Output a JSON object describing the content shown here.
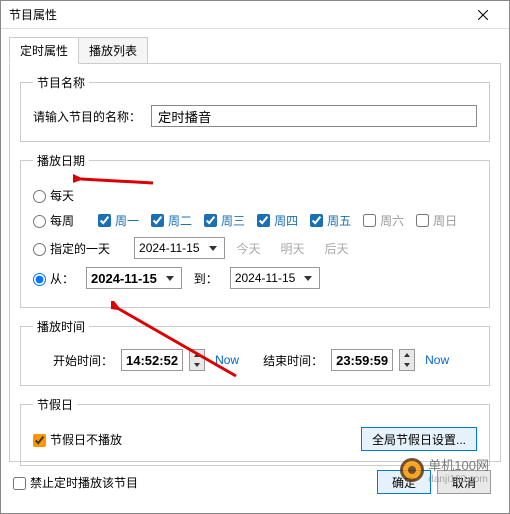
{
  "window": {
    "title": "节目属性"
  },
  "tabs": {
    "active": "定时属性",
    "other": "播放列表"
  },
  "program_name": {
    "legend": "节目名称",
    "label": "请输入节目的名称：",
    "value": "定时播音"
  },
  "play_date": {
    "legend": "播放日期",
    "daily": "每天",
    "weekly": "每周",
    "days": [
      "周一",
      "周二",
      "周三",
      "周四",
      "周五",
      "周六",
      "周日"
    ],
    "specific": "指定的一天",
    "today": "今天",
    "tomorrow": "明天",
    "after": "后天",
    "from": "从：",
    "to": "到：",
    "date1": "2024-11-15",
    "date2": "2024-11-15",
    "date3": "2024-11-15"
  },
  "play_time": {
    "legend": "播放时间",
    "start_label": "开始时间：",
    "end_label": "结束时间：",
    "start": "14:52:52",
    "end": "23:59:59",
    "now": "Now"
  },
  "holiday": {
    "legend": "节假日",
    "checkbox": "节假日不播放",
    "button": "全局节假日设置..."
  },
  "bottom": {
    "disable": "禁止定时播放该节目",
    "ok": "确定",
    "cancel": "取消"
  },
  "watermark": {
    "brand": "单机100网",
    "url": "danji100.com"
  }
}
